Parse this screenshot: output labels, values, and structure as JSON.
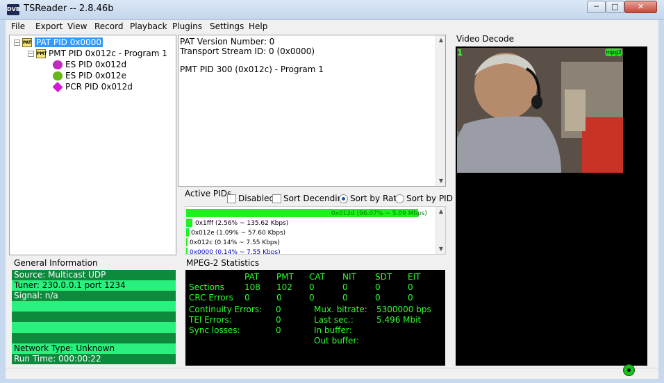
{
  "window": {
    "title": "TSReader -- 2.8.46b",
    "icon_text": "DVB",
    "minimize": "─",
    "maximize": "□",
    "close": "✕"
  },
  "menu": [
    "File",
    "Export",
    "View",
    "Record",
    "Playback",
    "Plugins",
    "Settings",
    "Help"
  ],
  "tree": {
    "pat": {
      "label": "PAT PID 0x0000",
      "icon": "PAT"
    },
    "pmt": {
      "label": "PMT PID 0x012c - Program 1",
      "icon": "PMT"
    },
    "es_audio": {
      "label": "ES PID 0x012d"
    },
    "es_video": {
      "label": "ES PID 0x012e"
    },
    "pcr": {
      "label": "PCR PID 0x012d"
    }
  },
  "pat_info": {
    "version": "PAT Version Number: 0",
    "tsid": "Transport Stream ID: 0 (0x0000)",
    "pmt": "PMT PID 300 (0x012c) - Program 1"
  },
  "active_pids": {
    "label": "Active PIDs",
    "disabled": "Disabled",
    "sort_desc": "Sort Decending",
    "sort_rate": "Sort by Rate",
    "sort_pid": "Sort by PID",
    "selected_sort": "Sort by Rate",
    "rows": [
      {
        "text": "0x012d (96.07% ~ 5.09 Mbps)",
        "percent": 96.07,
        "color": "#008000"
      },
      {
        "text": "0x1fff (2.56% ~ 135.62 Kbps)",
        "percent": 2.56,
        "color": "#000000"
      },
      {
        "text": "0x012e (1.09% ~ 57.60 Kbps)",
        "percent": 1.09,
        "color": "#000000"
      },
      {
        "text": "0x012c (0.14% ~ 7.55 Kbps)",
        "percent": 0.14,
        "color": "#000000"
      },
      {
        "text": "0x0000 (0.14% ~ 7.55 Kbps)",
        "percent": 0.14,
        "color": "#0000c0"
      }
    ]
  },
  "general_info": {
    "label": "General Information",
    "source": "Source: Multicast UDP",
    "tuner": "Tuner: 230.0.0.1 port 1234",
    "signal": "Signal: n/a",
    "network": "Network Type: Unknown",
    "runtime": "Run Time: 000:00:22"
  },
  "mpeg_stats": {
    "label": "MPEG-2 Statistics",
    "columns": [
      "PAT",
      "PMT",
      "CAT",
      "NIT",
      "SDT",
      "EIT"
    ],
    "sections_label": "Sections",
    "sections": [
      "108",
      "102",
      "0",
      "0",
      "0",
      "0"
    ],
    "crc_label": "CRC Errors",
    "crc": [
      "0",
      "0",
      "0",
      "0",
      "0",
      "0"
    ],
    "continuity_label": "Continuity Errors:",
    "continuity": "0",
    "tei_label": "TEI Errors:",
    "tei": "0",
    "sync_label": "Sync losses:",
    "sync": "0",
    "mux_label": "Mux. bitrate:",
    "mux": "5300000 bps",
    "last_label": "Last sec.:",
    "last": "5.496 Mbit",
    "inbuf_label": "In buffer:",
    "outbuf_label": "Out buffer:"
  },
  "video": {
    "label": "Video Decode",
    "channel": "1",
    "codec": "mpg2"
  }
}
